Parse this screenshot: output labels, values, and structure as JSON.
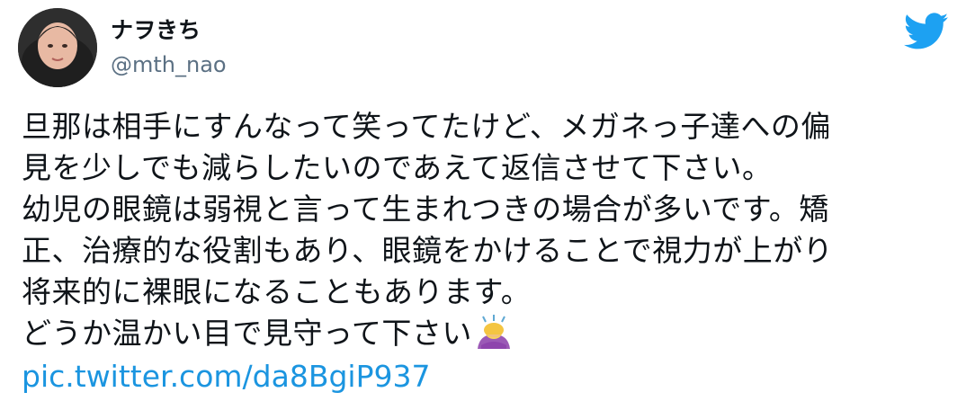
{
  "tweet": {
    "display_name": "ナヲきち",
    "handle": "@mth_nao",
    "lines": [
      "旦那は相手にすんなって笑ってたけど、メガネっ子達への偏",
      "見を少しでも減らしたいのであえて返信させて下さい。",
      "幼児の眼鏡は弱視と言って生まれつきの場合が多いです。矯",
      "正、治療的な役割もあり、眼鏡をかけることで視力が上がり",
      "将来的に裸眼になることもあります。",
      "どうか温かい目で見守って下さい"
    ],
    "link": "pic.twitter.com/da8BgiP937"
  },
  "icons": {
    "logo": "twitter-bird-icon",
    "emoji": "person-bowing-emoji",
    "avatar": "user-avatar"
  },
  "colors": {
    "brand": "#1da1f2",
    "link": "#1b95e0",
    "text": "#0f1419",
    "secondary": "#5b7083"
  }
}
